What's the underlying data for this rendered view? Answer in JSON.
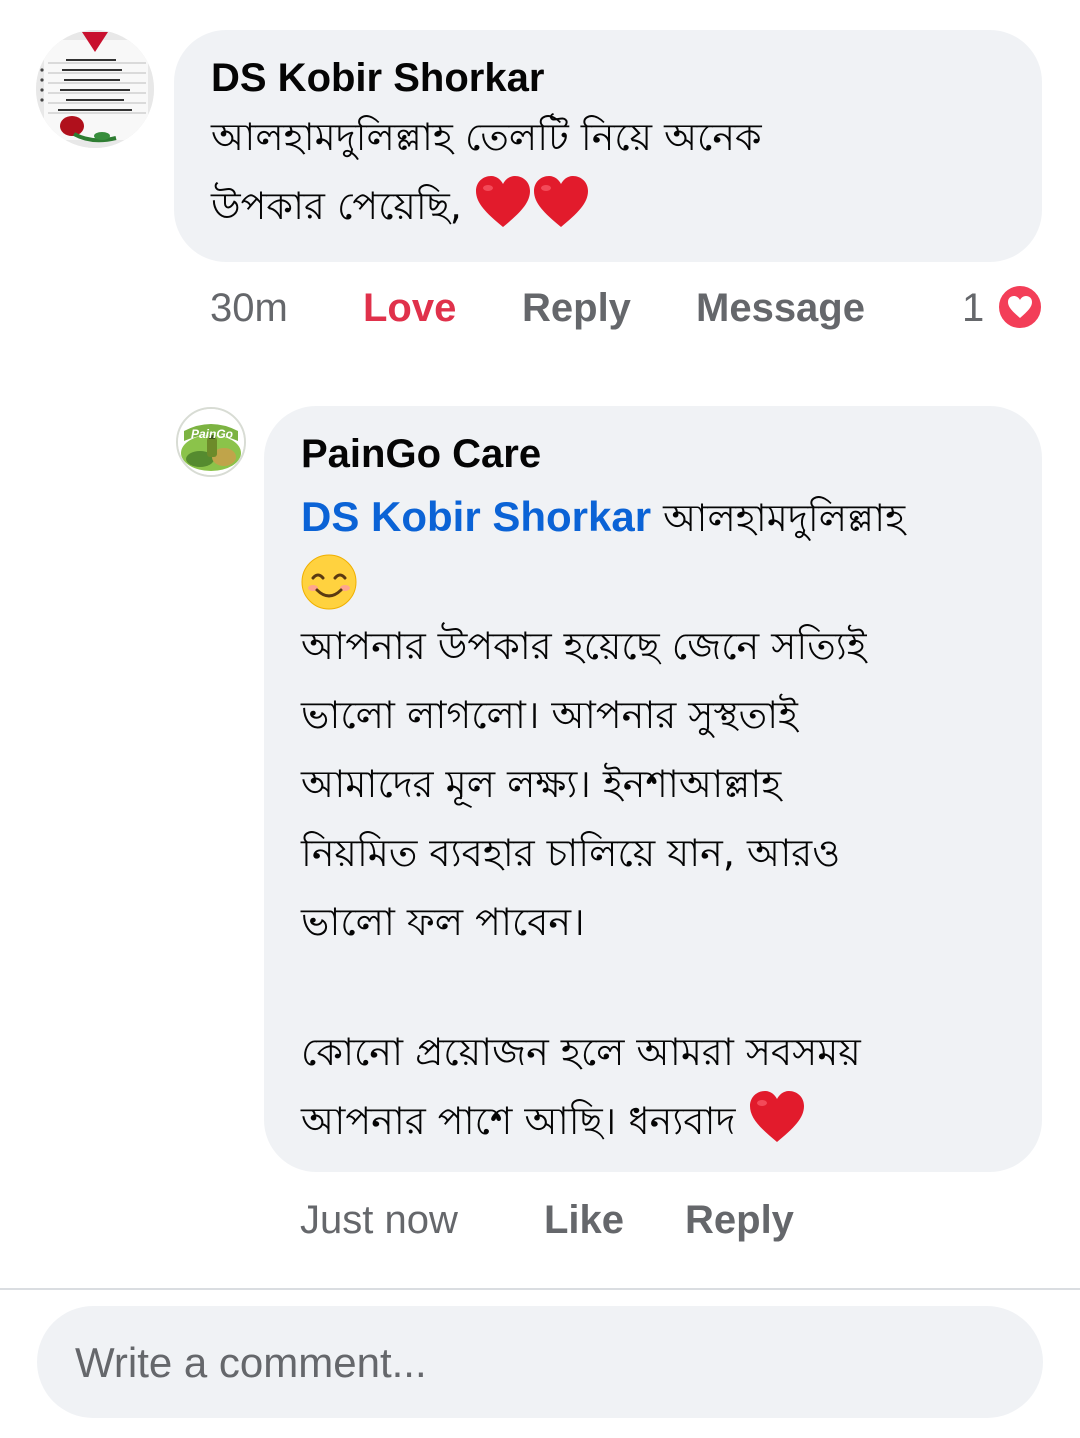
{
  "comment": {
    "author": "DS Kobir Shorkar",
    "lines": [
      "আলহামদুলিল্লাহ তেলটি নিয়ে অনেক",
      "উপকার পেয়েছি,"
    ],
    "time": "30m",
    "reaction_label": "Love",
    "reply_label": "Reply",
    "message_label": "Message",
    "reaction_count": "1",
    "avatar_icon": "poem-rose-avatar",
    "reaction_icon": "love-reaction-icon"
  },
  "reply": {
    "author": "PainGo Care",
    "mention": "DS Kobir Shorkar",
    "first_line_text": "আলহামদুলিল্লাহ",
    "paragraph_lines": [
      "আপনার উপকার হয়েছে জেনে সত্যিই",
      "ভালো লাগলো। আপনার সুস্থতাই",
      "আমাদের মূল লক্ষ্য। ইনশাআল্লাহ",
      "নিয়মিত ব্যবহার চালিয়ে যান, আরও",
      "ভালো ফল পাবেন।"
    ],
    "closing_lines": [
      "কোনো প্রয়োজন হলে আমরা সবসময়",
      "আপনার পাশে আছি। ধন্যবাদ"
    ],
    "time": "Just now",
    "like_label": "Like",
    "reply_label": "Reply",
    "avatar_icon": "paingo-logo-avatar"
  },
  "composer": {
    "placeholder": "Write a comment..."
  },
  "colors": {
    "bubble": "#f0f2f5",
    "mention": "#0b63d6",
    "love": "#e0314b",
    "muted": "#65676b"
  }
}
